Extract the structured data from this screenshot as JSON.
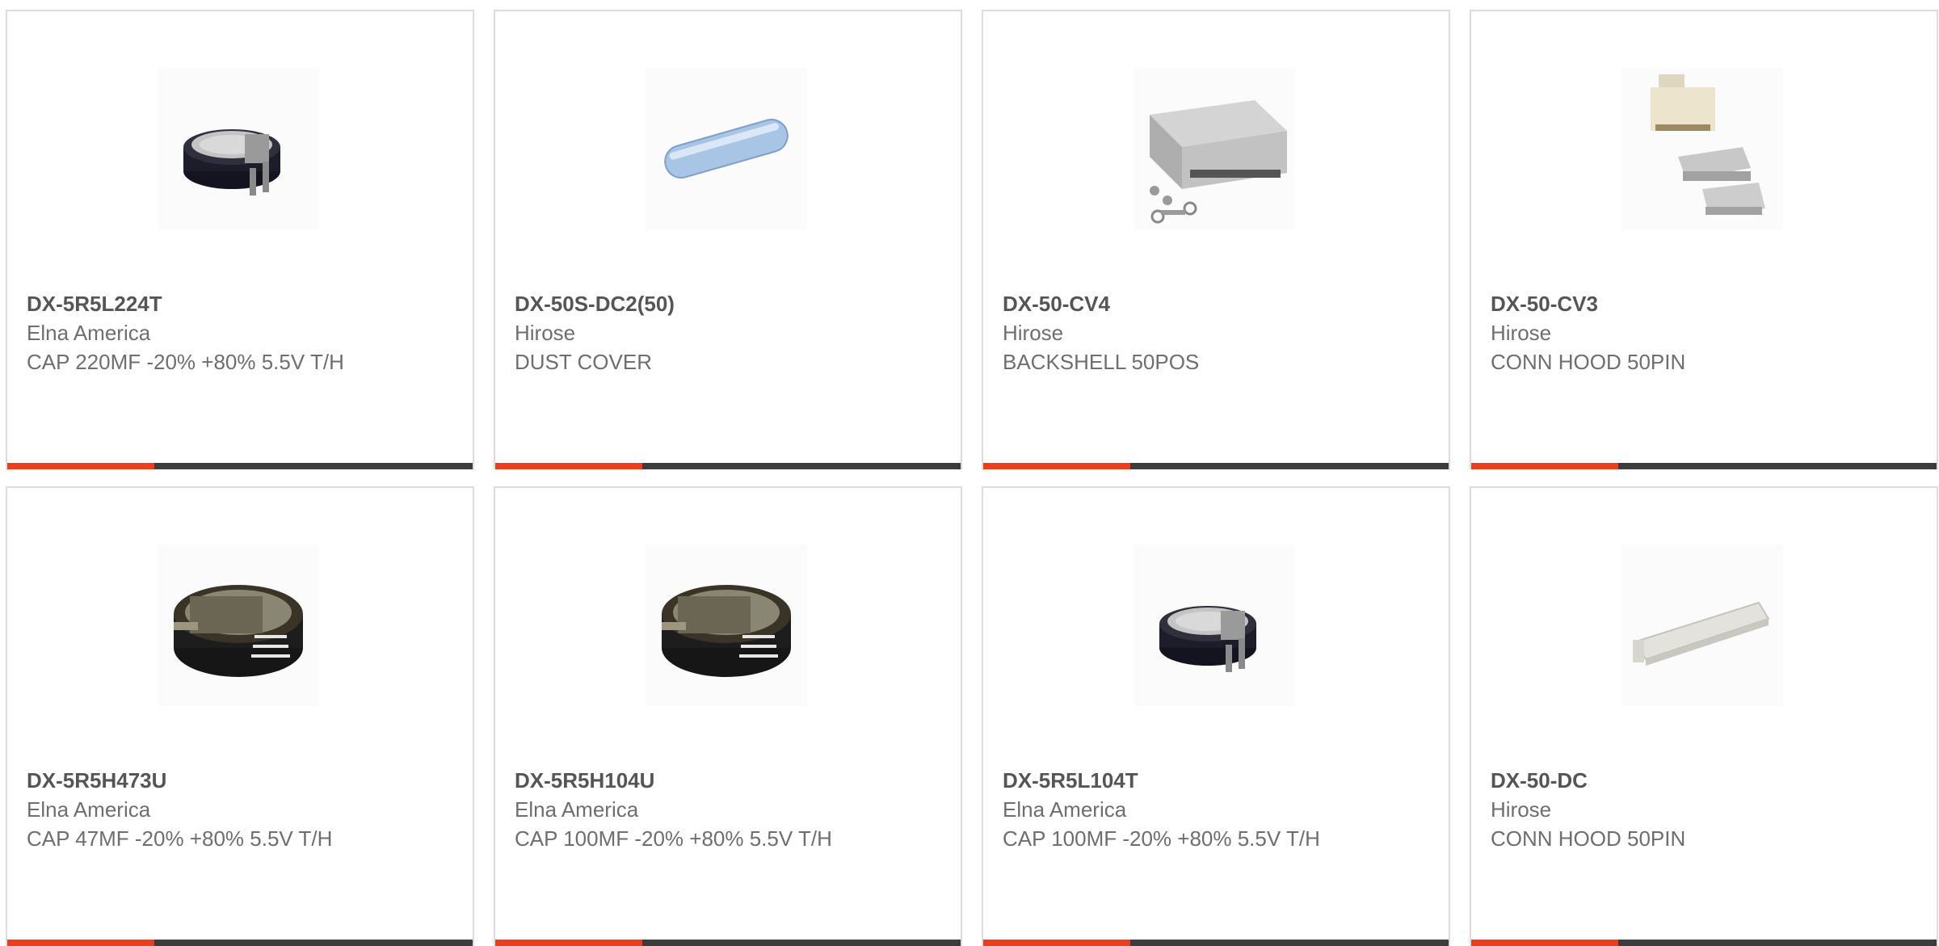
{
  "colors": {
    "accent": "#e8401c",
    "bar_dark": "#3c3c3c",
    "border": "#dcdcdc",
    "text": "#6e6e6e",
    "part_number": "#555555"
  },
  "products": [
    {
      "part_number": "DX-5R5L224T",
      "manufacturer": "Elna America",
      "description": "CAP 220MF -20% +80% 5.5V T/H",
      "image": "coin-capacitor-pins-icon"
    },
    {
      "part_number": "DX-50S-DC2(50)",
      "manufacturer": "Hirose",
      "description": "DUST COVER",
      "image": "dust-cover-tube-icon"
    },
    {
      "part_number": "DX-50-CV4",
      "manufacturer": "Hirose",
      "description": "BACKSHELL 50POS",
      "image": "backshell-icon"
    },
    {
      "part_number": "DX-50-CV3",
      "manufacturer": "Hirose",
      "description": "CONN HOOD 50PIN",
      "image": "conn-hood-kit-icon"
    },
    {
      "part_number": "DX-5R5H473U",
      "manufacturer": "Elna America",
      "description": "CAP 47MF -20% +80% 5.5V T/H",
      "image": "coin-capacitor-tab-icon"
    },
    {
      "part_number": "DX-5R5H104U",
      "manufacturer": "Elna America",
      "description": "CAP 100MF -20% +80% 5.5V T/H",
      "image": "coin-capacitor-tab-icon"
    },
    {
      "part_number": "DX-5R5L104T",
      "manufacturer": "Elna America",
      "description": "CAP 100MF -20% +80% 5.5V T/H",
      "image": "coin-capacitor-pins-icon"
    },
    {
      "part_number": "DX-50-DC",
      "manufacturer": "Hirose",
      "description": "CONN HOOD 50PIN",
      "image": "hood-cover-bar-icon"
    }
  ]
}
